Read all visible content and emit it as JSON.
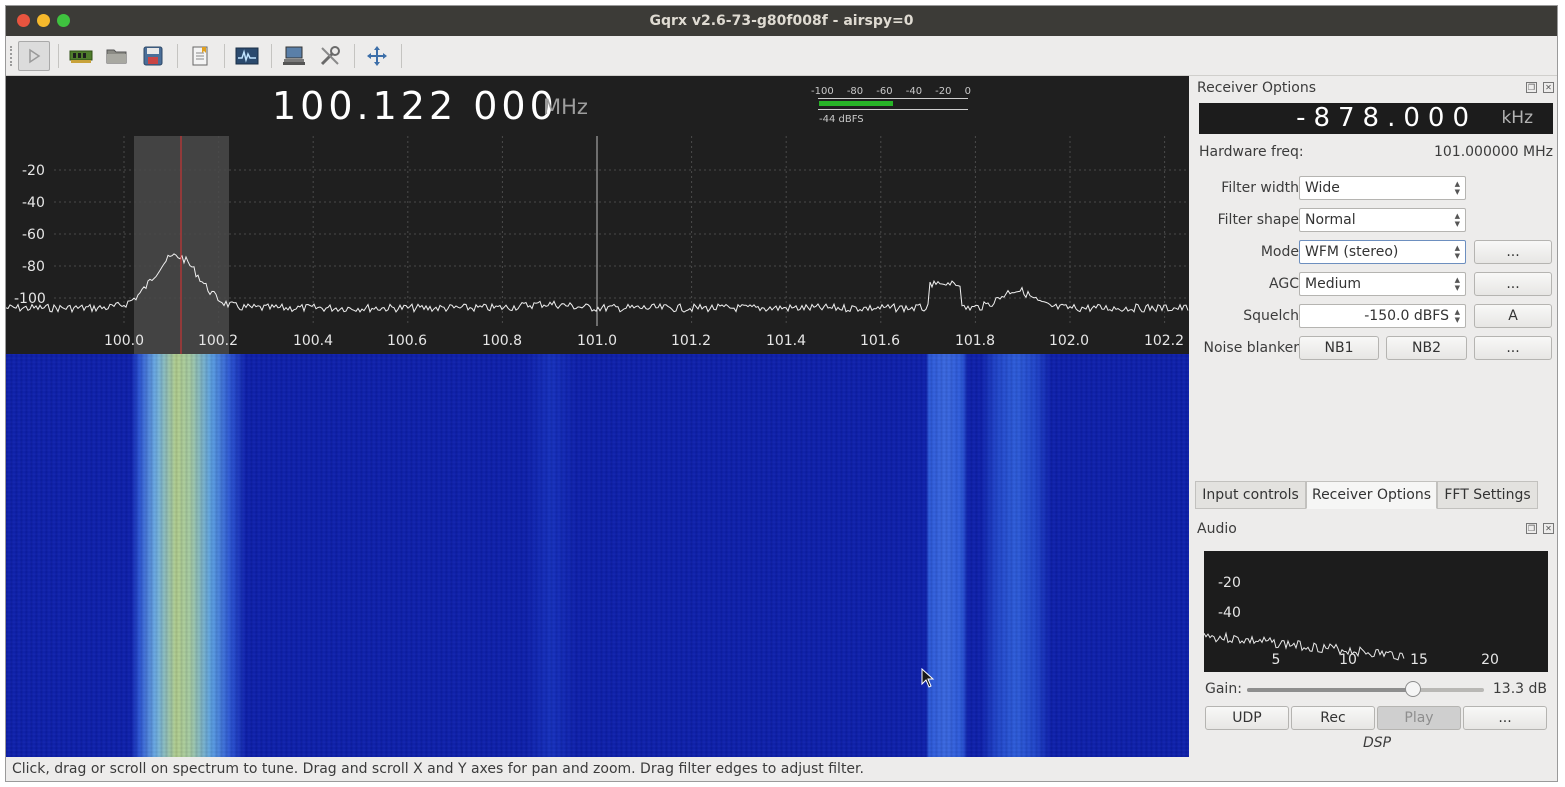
{
  "window": {
    "title": "Gqrx v2.6-73-g80f008f - airspy=0"
  },
  "toolbar": {
    "buttons": [
      "play-icon",
      "hardware-icon",
      "open-folder-icon",
      "save-icon",
      "bookmark-icon",
      "spectrum-icon",
      "network-icon",
      "tools-icon",
      "fullscreen-icon"
    ]
  },
  "main": {
    "frequency": "100.122 000",
    "frequency_unit": "MHz",
    "meter": {
      "ticks": [
        "-100",
        "-80",
        "-60",
        "-40",
        "-20",
        "0"
      ],
      "reading": "-44 dBFS",
      "level_fraction": 0.5
    },
    "spectrum": {
      "y_ticks": [
        "-20",
        "-40",
        "-60",
        "-80",
        "-100"
      ],
      "x_ticks": [
        "100.0",
        "100.2",
        "100.4",
        "100.6",
        "100.8",
        "101.0",
        "101.2",
        "101.4",
        "101.6",
        "101.8",
        "102.0",
        "102.2"
      ]
    }
  },
  "receiver": {
    "title": "Receiver Options",
    "offset_value": "-878.000",
    "offset_unit": "kHz",
    "hw_freq_label": "Hardware freq:",
    "hw_freq_value": "101.000000 MHz",
    "filter_width_label": "Filter width",
    "filter_width_value": "Wide",
    "filter_shape_label": "Filter shape",
    "filter_shape_value": "Normal",
    "mode_label": "Mode",
    "mode_value": "WFM (stereo)",
    "mode_more": "...",
    "agc_label": "AGC",
    "agc_value": "Medium",
    "agc_more": "...",
    "squelch_label": "Squelch",
    "squelch_value": "-150.0 dBFS",
    "squelch_auto": "A",
    "nb_label": "Noise blanker",
    "nb1": "NB1",
    "nb2": "NB2",
    "nb_more": "..."
  },
  "tabs": [
    "Input controls",
    "Receiver Options",
    "FFT Settings"
  ],
  "audio": {
    "title": "Audio",
    "y_ticks": [
      "-20",
      "-40"
    ],
    "x_ticks": [
      "5",
      "10",
      "15",
      "20"
    ],
    "gain_label": "Gain:",
    "gain_value": "13.3 dB",
    "gain_fraction": 0.7,
    "udp": "UDP",
    "rec": "Rec",
    "play": "Play",
    "more": "...",
    "dsp": "DSP"
  },
  "status": "Click, drag or scroll on spectrum to tune. Drag and scroll X and Y axes for pan and zoom. Drag filter edges to adjust filter."
}
